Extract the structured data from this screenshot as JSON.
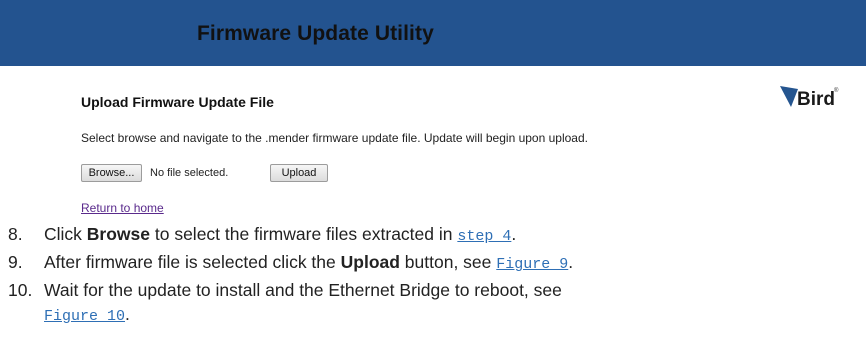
{
  "header": {
    "title": "Firmware Update Utility"
  },
  "upload": {
    "section_title": "Upload Firmware Update File",
    "instruction": "Select browse and navigate to the .mender firmware update file. Update will begin upon upload.",
    "browse_label": "Browse...",
    "file_status": "No file selected.",
    "upload_label": "Upload",
    "home_link": "Return to home"
  },
  "logo": {
    "text": "Bird",
    "mark": "®"
  },
  "steps": [
    {
      "num": "8.",
      "pre": "Click ",
      "bold": "Browse",
      "mid": " to select the firmware files extracted in ",
      "link": "step 4",
      "post": "."
    },
    {
      "num": "9.",
      "pre": "After firmware file is selected click the ",
      "bold": "Upload",
      "mid": " button, see ",
      "link": "Figure 9",
      "post": "."
    },
    {
      "num": "10.",
      "pre": "Wait for the update to install and the Ethernet Bridge to reboot, see",
      "link": "Figure 10",
      "post": "."
    }
  ],
  "colors": {
    "header_bg": "#23538f",
    "link": "#2e6fb5",
    "visited_link": "#5a2a8c"
  }
}
